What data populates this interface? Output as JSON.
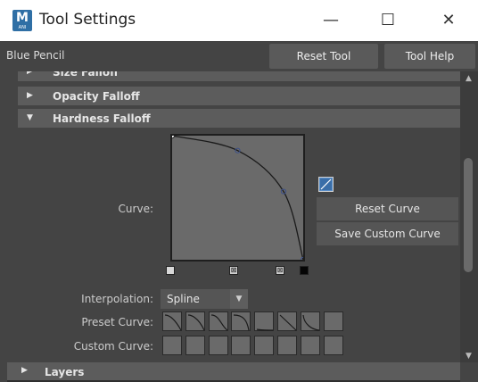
{
  "window": {
    "app_icon_letter": "M",
    "app_icon_sub": "ANI",
    "title": "Tool Settings",
    "minimize_glyph": "—",
    "maximize_glyph": "☐",
    "close_glyph": "✕"
  },
  "toolbar": {
    "tool_name": "Blue Pencil",
    "reset_tool_label": "Reset Tool",
    "tool_help_label": "Tool Help"
  },
  "sections": {
    "size_falloff": "Size Falloff",
    "opacity_falloff": "Opacity Falloff",
    "hardness_falloff": "Hardness Falloff",
    "layers": "Layers"
  },
  "curve_editor": {
    "label": "Curve:",
    "reset_curve_label": "Reset Curve",
    "save_custom_curve_label": "Save Custom Curve",
    "edit_icon": "curve-edit-icon",
    "curve_points": [
      [
        0.0,
        1.0
      ],
      [
        0.5,
        0.88
      ],
      [
        0.85,
        0.55
      ],
      [
        1.0,
        0.0
      ]
    ]
  },
  "interpolation": {
    "label": "Interpolation:",
    "value": "Spline"
  },
  "preset_curve": {
    "label": "Preset Curve:",
    "count": 8
  },
  "custom_curve": {
    "label": "Custom Curve:",
    "count": 8
  },
  "colors": {
    "background": "#444444",
    "section_header": "#5c5c5c",
    "curve_area": "#6a6a6a",
    "button": "#555555",
    "titlebar": "#ffffff",
    "accent": "#2f6fa5"
  }
}
